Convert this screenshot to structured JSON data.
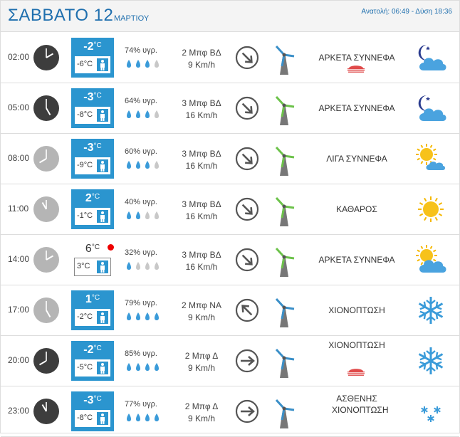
{
  "header": {
    "day": "ΣΑΒΒΑΤΟ 12",
    "month": "ΜΑΡΤΙΟΥ",
    "sun": "Ανατολή: 06:49  - Δύση 18:36"
  },
  "colors": {
    "accent": "#2b95cf",
    "title": "#1f6fae",
    "drop_on": "#3a9bd9",
    "drop_off": "#c8c8c8",
    "alert": "#e00000"
  },
  "rows": [
    {
      "time": "02:00",
      "clock": "night",
      "temp": "-2",
      "unit": "°C",
      "feel": "-6°C",
      "humidity": "74% υγρ.",
      "drops_filled": 3,
      "wind_force": "2 Μπφ ΒΔ",
      "wind_speed": "9 Km/h",
      "wind_dir": "ΒΔ",
      "wind_color": "blue",
      "desc": "ΑΡΚΕΤΑ ΣΥΝΝΕΦΑ",
      "snowbar": true,
      "icon": "moon-cloud-icon"
    },
    {
      "time": "05:00",
      "clock": "night",
      "temp": "-3",
      "unit": "°C",
      "feel": "-8°C",
      "humidity": "64% υγρ.",
      "drops_filled": 3,
      "wind_force": "3 Μπφ ΒΔ",
      "wind_speed": "16 Km/h",
      "wind_dir": "ΒΔ",
      "wind_color": "green",
      "desc": "ΑΡΚΕΤΑ ΣΥΝΝΕΦΑ",
      "snowbar": false,
      "icon": "moon-cloud-icon"
    },
    {
      "time": "08:00",
      "clock": "day",
      "temp": "-3",
      "unit": "°C",
      "feel": "-9°C",
      "humidity": "60% υγρ.",
      "drops_filled": 3,
      "wind_force": "3 Μπφ ΒΔ",
      "wind_speed": "16 Km/h",
      "wind_dir": "ΒΔ",
      "wind_color": "green",
      "desc": "ΛΙΓΑ ΣΥΝΝΕΦΑ",
      "snowbar": false,
      "icon": "sun-cloud-small-icon"
    },
    {
      "time": "11:00",
      "clock": "day",
      "temp": "2",
      "unit": "°C",
      "feel": "-1°C",
      "humidity": "40% υγρ.",
      "drops_filled": 2,
      "wind_force": "3 Μπφ ΒΔ",
      "wind_speed": "16 Km/h",
      "wind_dir": "ΒΔ",
      "wind_color": "green",
      "desc": "ΚΑΘΑΡΟΣ",
      "snowbar": false,
      "icon": "sun-icon"
    },
    {
      "time": "14:00",
      "clock": "day",
      "temp": "6",
      "unit": "°C",
      "feel": "3°C",
      "light": true,
      "alert": true,
      "humidity": "32% υγρ.",
      "drops_filled": 1,
      "wind_force": "3 Μπφ ΒΔ",
      "wind_speed": "16 Km/h",
      "wind_dir": "ΒΔ",
      "wind_color": "green",
      "desc": "ΑΡΚΕΤΑ ΣΥΝΝΕΦΑ",
      "snowbar": false,
      "icon": "sun-cloud-icon"
    },
    {
      "time": "17:00",
      "clock": "day",
      "temp": "1",
      "unit": "°C",
      "feel": "-2°C",
      "humidity": "79% υγρ.",
      "drops_filled": 4,
      "wind_force": "2 Μπφ ΝΑ",
      "wind_speed": "9 Km/h",
      "wind_dir": "ΝΑ",
      "wind_color": "blue",
      "desc": "ΧΙΟΝΟΠΤΩΣΗ",
      "snowbar": false,
      "icon": "snowflake-icon"
    },
    {
      "time": "20:00",
      "clock": "night",
      "temp": "-2",
      "unit": "°C",
      "feel": "-5°C",
      "humidity": "85% υγρ.",
      "drops_filled": 4,
      "wind_force": "2 Μπφ Δ",
      "wind_speed": "9 Km/h",
      "wind_dir": "Δ",
      "wind_color": "blue",
      "desc": "ΧΙΟΝΟΠΤΩΣΗ",
      "desc_pos": "top",
      "snowbar": true,
      "icon": "snowflake-icon"
    },
    {
      "time": "23:00",
      "clock": "night",
      "temp": "-3",
      "unit": "°C",
      "feel": "-8°C",
      "humidity": "77% υγρ.",
      "drops_filled": 4,
      "wind_force": "2 Μπφ Δ",
      "wind_speed": "9 Km/h",
      "wind_dir": "Δ",
      "wind_color": "blue",
      "desc": "ΑΣΘΕΝΗΣ ΧΙΟΝΟΠΤΩΣΗ",
      "desc2": true,
      "snowbar": false,
      "icon": "light-snow-icon"
    }
  ]
}
